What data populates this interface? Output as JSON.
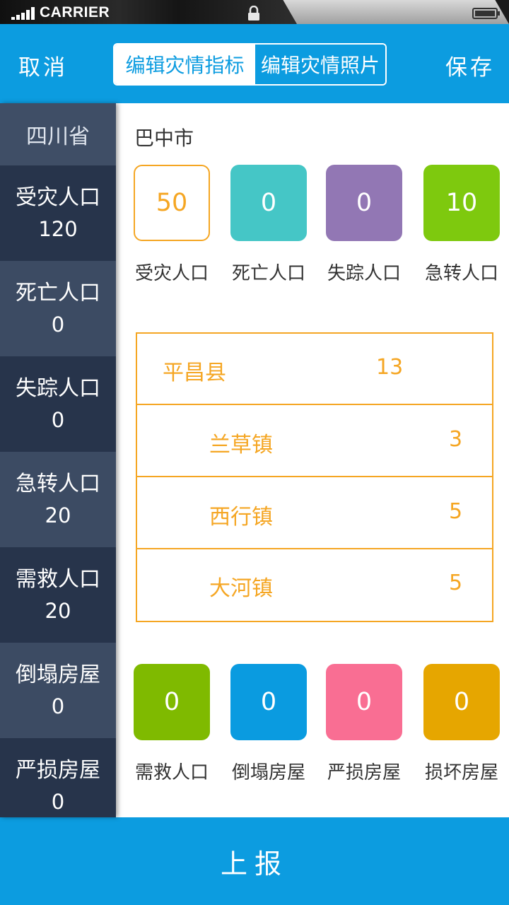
{
  "status_bar": {
    "carrier": "CARRIER"
  },
  "nav": {
    "cancel": "取消",
    "save": "保存",
    "tabs": [
      {
        "label": "编辑灾情指标",
        "active": true
      },
      {
        "label": "编辑灾情照片",
        "active": false
      }
    ]
  },
  "sidebar": {
    "province": "四川省",
    "items": [
      {
        "label": "受灾人口",
        "value": "120"
      },
      {
        "label": "死亡人口",
        "value": "0"
      },
      {
        "label": "失踪人口",
        "value": "0"
      },
      {
        "label": "急转人口",
        "value": "20"
      },
      {
        "label": "需救人口",
        "value": "20"
      },
      {
        "label": "倒塌房屋",
        "value": "0"
      },
      {
        "label": "严损房屋",
        "value": "0"
      }
    ]
  },
  "main": {
    "city": "巴中市",
    "top_tiles": [
      {
        "value": "50",
        "label": "受灾人口",
        "color": "#f5a623"
      },
      {
        "value": "0",
        "label": "死亡人口",
        "color": "#45c6c6"
      },
      {
        "value": "0",
        "label": "失踪人口",
        "color": "#9277b4"
      },
      {
        "value": "10",
        "label": "急转人口",
        "color": "#7ec90e"
      }
    ],
    "table": {
      "county": {
        "name": "平昌县",
        "value": "13"
      },
      "towns": [
        {
          "name": "兰草镇",
          "value": "3"
        },
        {
          "name": "西行镇",
          "value": "5"
        },
        {
          "name": "大河镇",
          "value": "5"
        }
      ]
    },
    "bottom_tiles": [
      {
        "value": "0",
        "label": "需救人口",
        "color": "#7fba00"
      },
      {
        "value": "0",
        "label": "倒塌房屋",
        "color": "#0a9be0"
      },
      {
        "value": "0",
        "label": "严损房屋",
        "color": "#f96e93"
      },
      {
        "value": "0",
        "label": "损坏房屋",
        "color": "#e6a600"
      }
    ]
  },
  "footer": {
    "submit": "上报"
  }
}
